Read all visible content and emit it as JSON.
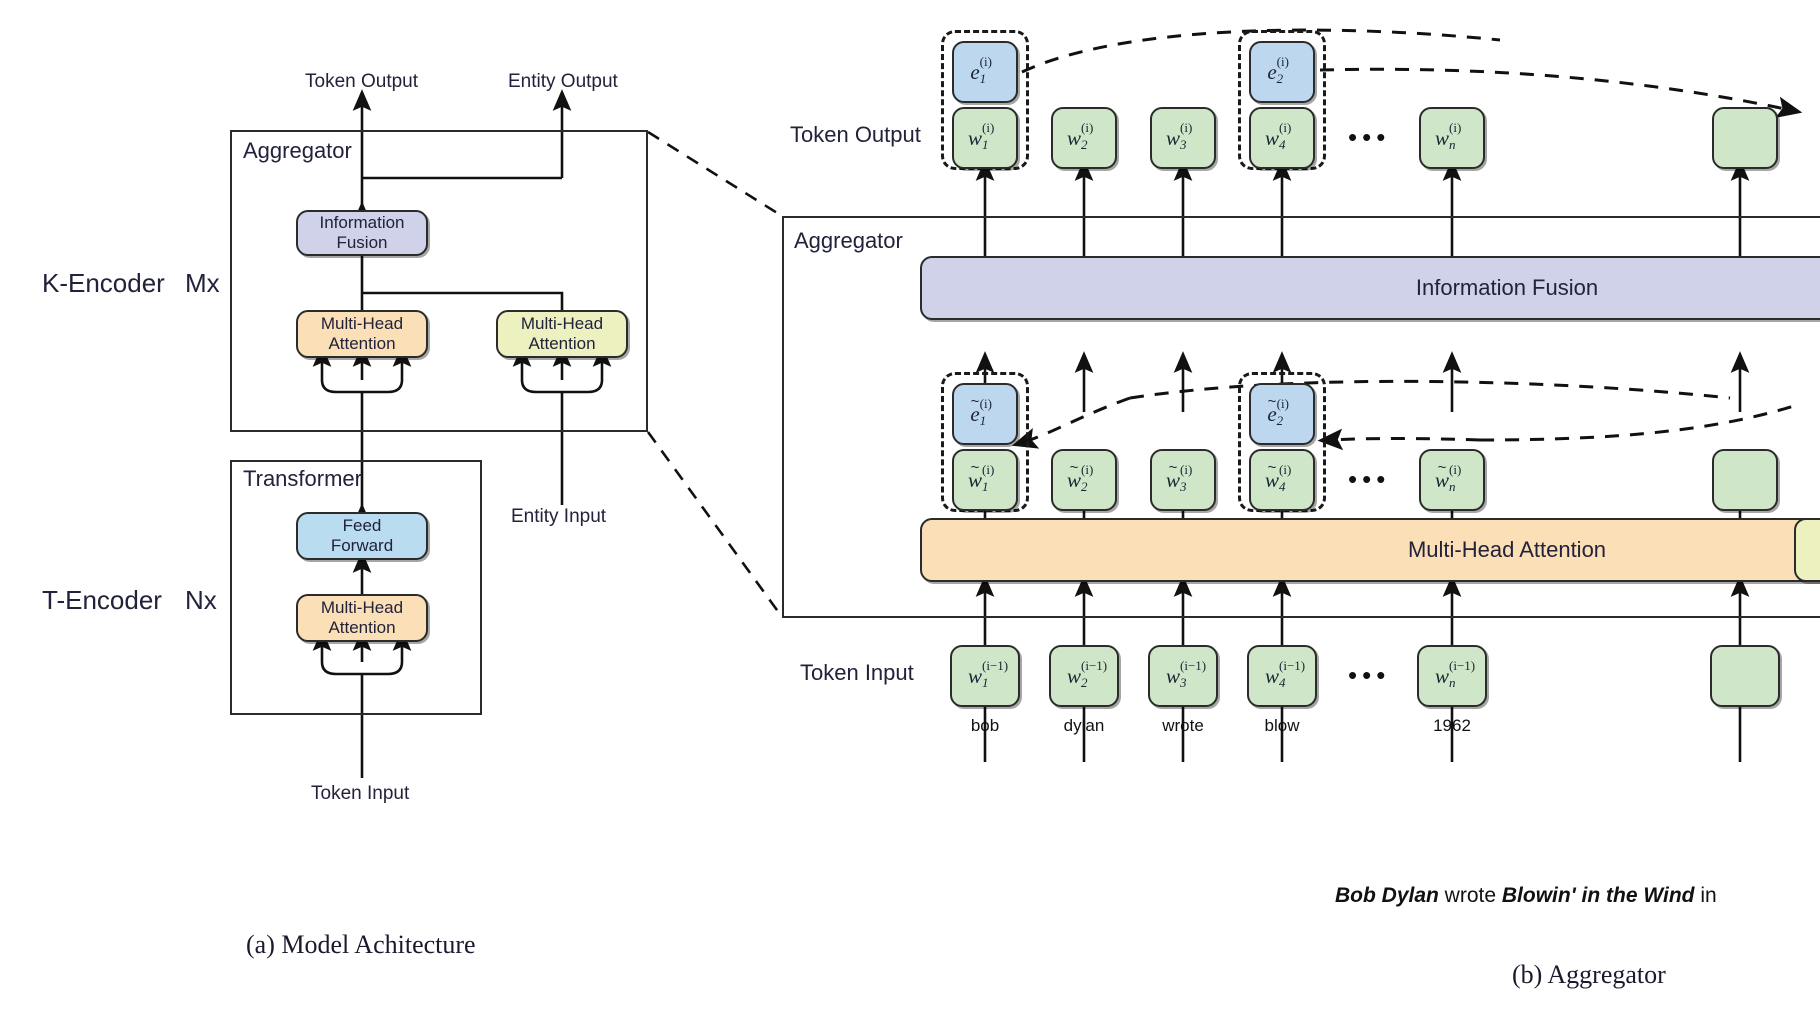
{
  "figure": {
    "caption_a": "(a) Model Achitecture",
    "caption_b": "(b) Aggregator"
  },
  "panel_a": {
    "labels": {
      "token_output": "Token Output",
      "entity_output": "Entity Output",
      "entity_input": "Entity Input",
      "token_input": "Token Input",
      "k_encoder": "K-Encoder",
      "k_encoder_reps": "Mx",
      "t_encoder": "T-Encoder",
      "t_encoder_reps": "Nx",
      "aggregator": "Aggregator",
      "transformer": "Transformer"
    },
    "blocks": {
      "information_fusion": "Information\nFusion",
      "multi_head_attention_token": "Multi-Head\nAttention",
      "multi_head_attention_entity": "Multi-Head\nAttention",
      "feed_forward": "Feed\nForward",
      "multi_head_attention_transformer": "Multi-Head\nAttention"
    }
  },
  "panel_b": {
    "labels": {
      "token_output": "Token Output",
      "aggregator": "Aggregator",
      "token_input": "Token Input",
      "information_fusion": "Information Fusion",
      "multi_head_attention": "Multi-Head Attention",
      "ellipsis": "•••"
    },
    "output_entities": [
      {
        "base": "e",
        "sub": "1",
        "sup": "(i)",
        "tilde": false
      },
      {
        "base": "e",
        "sub": "2",
        "sup": "(i)",
        "tilde": false
      }
    ],
    "output_tokens": [
      {
        "base": "w",
        "sub": "1",
        "sup": "(i)"
      },
      {
        "base": "w",
        "sub": "2",
        "sup": "(i)"
      },
      {
        "base": "w",
        "sub": "3",
        "sup": "(i)"
      },
      {
        "base": "w",
        "sub": "4",
        "sup": "(i)"
      },
      {
        "base": "w",
        "sub": "n",
        "sup": "(i)"
      }
    ],
    "mid_entities": [
      {
        "base": "e",
        "sub": "1",
        "sup": "(i)",
        "tilde": true
      },
      {
        "base": "e",
        "sub": "2",
        "sup": "(i)",
        "tilde": true
      }
    ],
    "mid_tokens": [
      {
        "base": "w",
        "sub": "1",
        "sup": "(i)",
        "tilde": true
      },
      {
        "base": "w",
        "sub": "2",
        "sup": "(i)",
        "tilde": true
      },
      {
        "base": "w",
        "sub": "3",
        "sup": "(i)",
        "tilde": true
      },
      {
        "base": "w",
        "sub": "4",
        "sup": "(i)",
        "tilde": true
      },
      {
        "base": "w",
        "sub": "n",
        "sup": "(i)",
        "tilde": true
      }
    ],
    "input_tokens": [
      {
        "base": "w",
        "sub": "1",
        "sup": "(i−1)",
        "word": "bob"
      },
      {
        "base": "w",
        "sub": "2",
        "sup": "(i−1)",
        "word": "dylan"
      },
      {
        "base": "w",
        "sub": "3",
        "sup": "(i−1)",
        "word": "wrote"
      },
      {
        "base": "w",
        "sub": "4",
        "sup": "(i−1)",
        "word": "blow"
      },
      {
        "base": "w",
        "sub": "n",
        "sup": "(i−1)",
        "word": "1962"
      }
    ],
    "example_sentence": {
      "part1": "Bob Dylan",
      "part2": " wrote ",
      "part3": "Blowin' in the Wind",
      "part4": " in"
    }
  },
  "colors": {
    "orange": "#fbdfb6",
    "yellow": "#edf0bf",
    "blue": "#b9dcf0",
    "purple": "#cfd2e8",
    "green": "#cfe6c8",
    "entity_blue": "#bcd7ee",
    "stroke": "#2b2b2b"
  }
}
